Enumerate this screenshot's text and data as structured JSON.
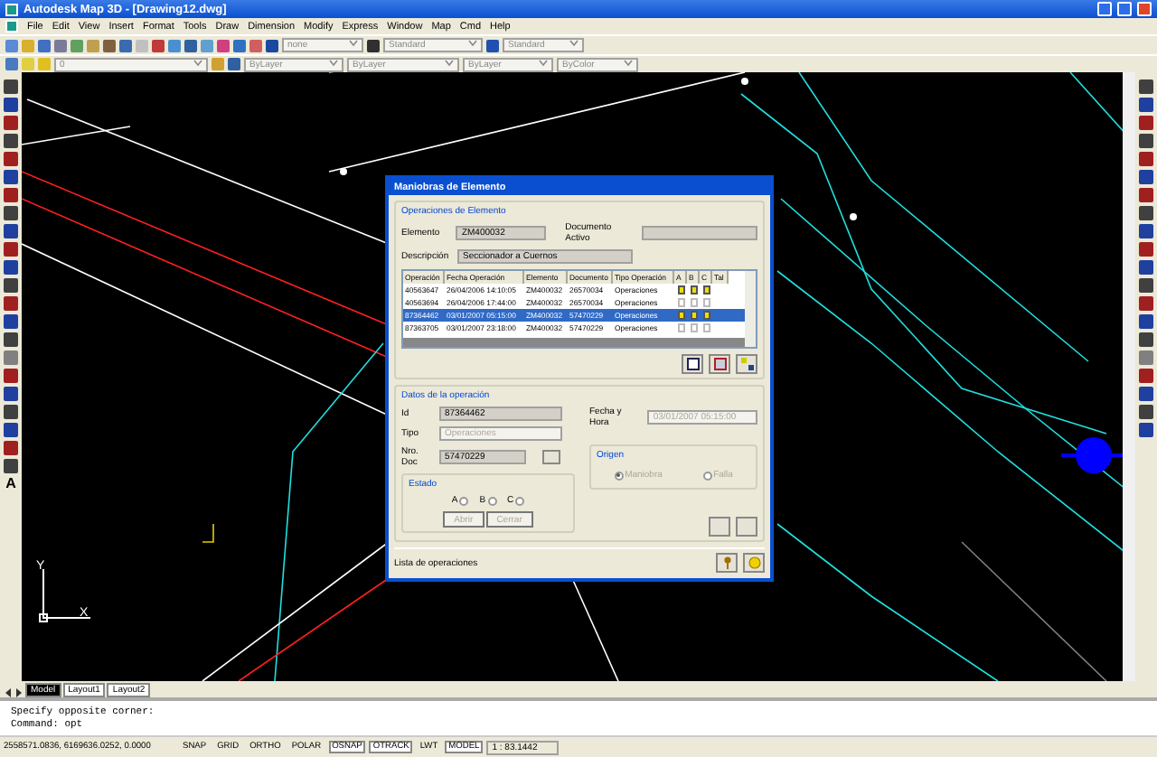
{
  "window": {
    "title": "Autodesk Map 3D - [Drawing12.dwg]"
  },
  "menu": [
    "File",
    "Edit",
    "View",
    "Insert",
    "Format",
    "Tools",
    "Draw",
    "Dimension",
    "Modify",
    "Express",
    "Window",
    "Map",
    "Cmd",
    "Help"
  ],
  "toolbar": {
    "text_style": "none",
    "dim_style": "Standard",
    "table_style": "Standard"
  },
  "properties_bar": {
    "layer": "0",
    "object_colour": "ByLayer",
    "linetype": "ByLayer",
    "lineweight": "ByLayer",
    "plot_style": "ByColor"
  },
  "draw_toolbar": {
    "text_tool": "A"
  },
  "ucs_icon": {
    "x_label": "X",
    "y_label": "Y"
  },
  "dialog": {
    "title": "Maniobras de Elemento",
    "operations_group": {
      "title": "Operaciones de Elemento",
      "elemento_label": "Elemento",
      "elemento": "ZM400032",
      "documento_activo_label": "Documento Activo",
      "descripcion_label": "Descripción",
      "descripcion": "Seccionador a Cuernos",
      "table": {
        "columns": [
          "Operación",
          "Fecha Operación",
          "Elemento",
          "Documento",
          "Tipo Operación",
          "A",
          "B",
          "C",
          "Tal"
        ],
        "rows": [
          {
            "cells": [
              "40563647",
              "26/04/2006 14:10:05",
              "ZM400032",
              "26570034",
              "Operaciones"
            ],
            "a": true,
            "b": true,
            "c": true,
            "selected": false
          },
          {
            "cells": [
              "40563694",
              "26/04/2006 17:44:00",
              "ZM400032",
              "26570034",
              "Operaciones"
            ],
            "a": false,
            "b": false,
            "c": false,
            "selected": false
          },
          {
            "cells": [
              "87364462",
              "03/01/2007 05:15:00",
              "ZM400032",
              "57470229",
              "Operaciones"
            ],
            "a": true,
            "b": true,
            "c": true,
            "selected": true
          },
          {
            "cells": [
              "87363705",
              "03/01/2007 23:18:00",
              "ZM400032",
              "57470229",
              "Operaciones"
            ],
            "a": false,
            "b": false,
            "c": false,
            "selected": false
          }
        ]
      }
    },
    "data_group": {
      "title": "Datos de la operación",
      "id_label": "Id",
      "id": "87364462",
      "tipo_label": "Tipo",
      "tipo": "Operaciones",
      "nro_doc_label": "Nro. Doc",
      "nro_doc": "57470229",
      "fecha_label": "Fecha y Hora",
      "fecha": "03/01/2007 05:15:00",
      "estado": {
        "title": "Estado",
        "options": [
          {
            "label": "A",
            "checked": false
          },
          {
            "label": "B",
            "checked": false
          },
          {
            "label": "C",
            "checked": false
          }
        ],
        "buttons": [
          "Abrir",
          "Cerrar"
        ]
      },
      "origen": {
        "title": "Origen",
        "options": [
          {
            "label": "Maniobra",
            "selected": true
          },
          {
            "label": "Falla",
            "selected": false
          }
        ]
      }
    },
    "footer": {
      "label": "Lista de operaciones"
    }
  },
  "layout_tabs": [
    {
      "label": "Model",
      "selected": true
    },
    {
      "label": "Layout1",
      "selected": false
    },
    {
      "label": "Layout2",
      "selected": false
    }
  ],
  "command_lines": [
    "Specify opposite corner:",
    "Command: opt"
  ],
  "status_bar": {
    "coordinates": "2558571.0836, 6169636.0252, 0.0000",
    "toggles": [
      {
        "label": "SNAP",
        "on": false
      },
      {
        "label": "GRID",
        "on": false
      },
      {
        "label": "ORTHO",
        "on": false
      },
      {
        "label": "POLAR",
        "on": false
      },
      {
        "label": "OSNAP",
        "on": true
      },
      {
        "label": "OTRACK",
        "on": true
      },
      {
        "label": "LWT",
        "on": false
      },
      {
        "label": "MODEL",
        "on": true
      }
    ],
    "scale": "1 : 83.1442"
  }
}
